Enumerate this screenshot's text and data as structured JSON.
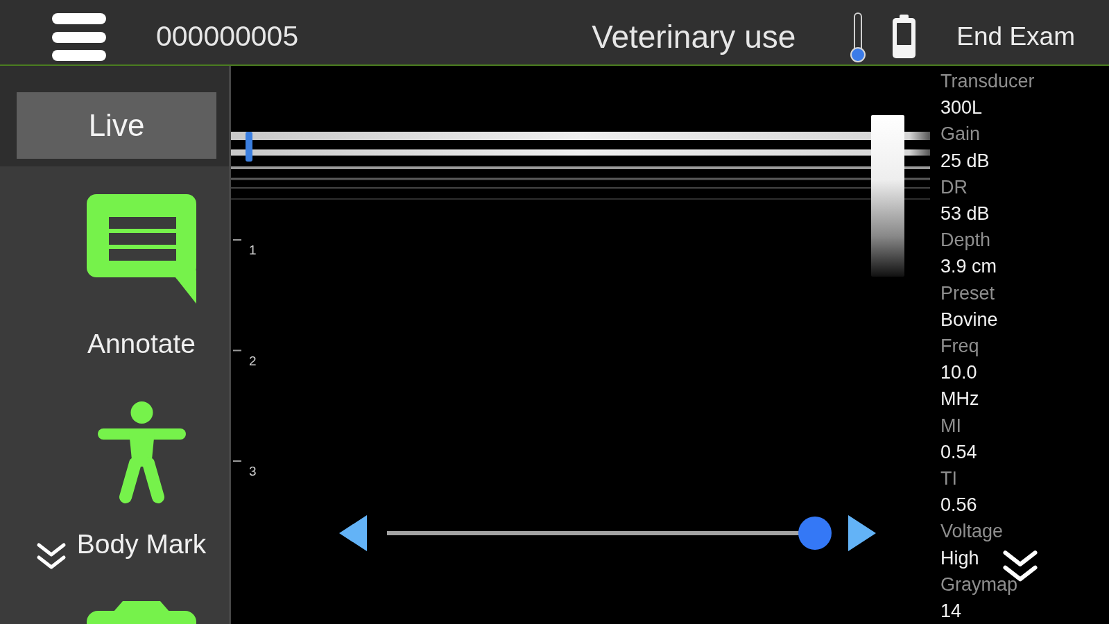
{
  "top_bar": {
    "exam_id": "000000005",
    "mode_label": "Veterinary use",
    "end_button": "End Exam"
  },
  "sidebar": {
    "live_button": "Live",
    "tools": [
      {
        "kind": "annotate",
        "label": "Annotate"
      },
      {
        "kind": "body_mark",
        "label": "Body Mark"
      },
      {
        "kind": "camera"
      }
    ]
  },
  "image": {
    "depth_scale": [
      "1",
      "2",
      "3"
    ],
    "cine_slider": {
      "level": 1
    }
  },
  "parameters": [
    {
      "label": "Transducer",
      "value_lines": [
        "300L"
      ]
    },
    {
      "label": "Gain",
      "value_lines": [
        "25 dB"
      ]
    },
    {
      "label": "DR",
      "value_lines": [
        "53 dB"
      ]
    },
    {
      "label": "Depth",
      "value_lines": [
        "3.9 cm"
      ]
    },
    {
      "label": "Preset",
      "value_lines": [
        "Bovine"
      ]
    },
    {
      "label": "Freq",
      "value_lines": [
        "10.0",
        "MHz"
      ]
    },
    {
      "label": "MI",
      "value_lines": [
        "0.54"
      ]
    },
    {
      "label": "TI",
      "value_lines": [
        "0.56"
      ]
    },
    {
      "label": "Voltage",
      "value_lines": [
        "High"
      ]
    },
    {
      "label": "Graymap",
      "value_lines": [
        "14"
      ]
    }
  ]
}
